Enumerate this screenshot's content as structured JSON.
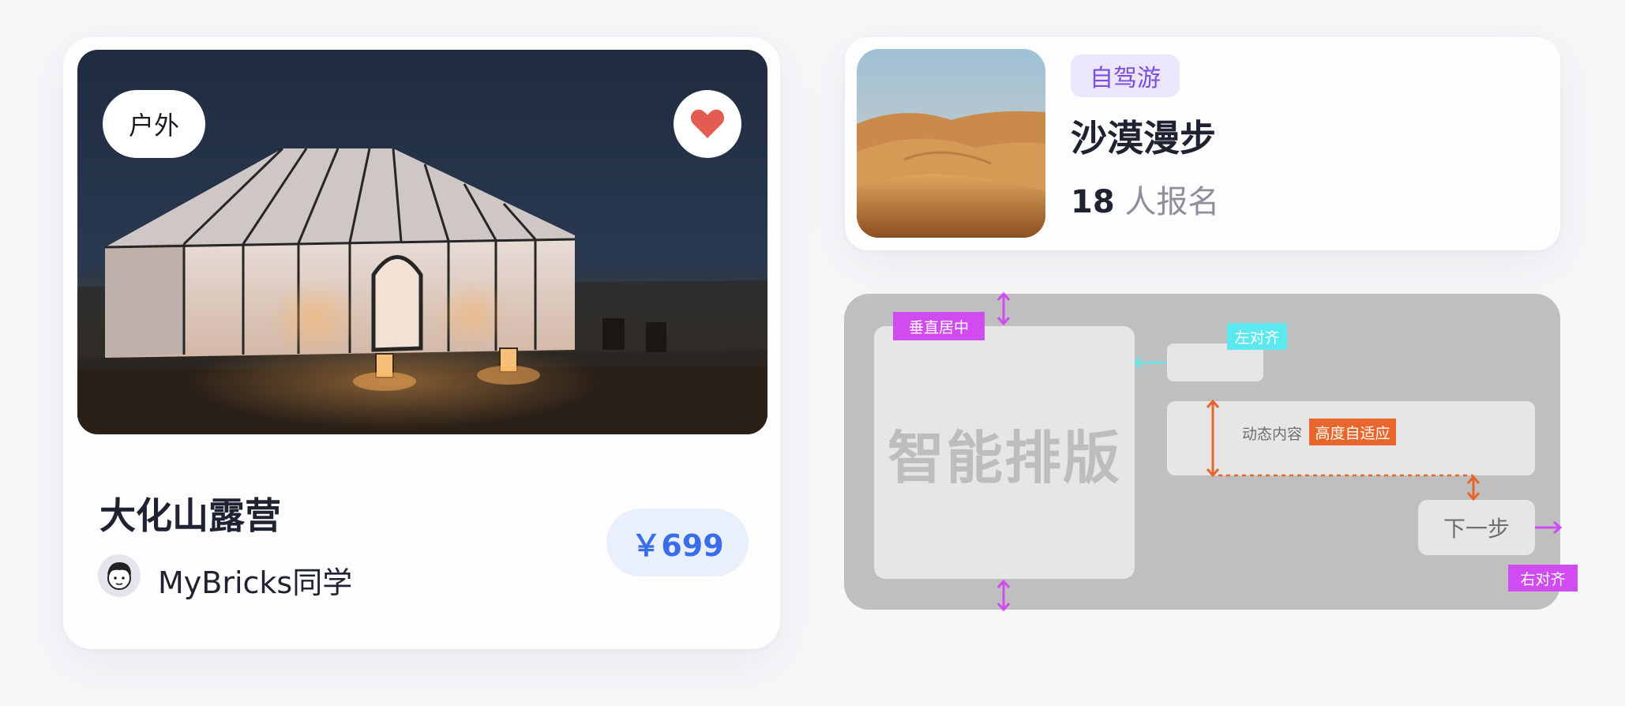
{
  "product_card": {
    "tag": "户外",
    "title": "大化山露营",
    "author": "MyBricks同学",
    "price": "￥699",
    "favorited": true,
    "hero_image": "night-desert-tent-photo",
    "colors": {
      "price_text": "#3a6ee8",
      "price_bg": "#e9f0fb",
      "heart": "#e45b52"
    }
  },
  "activity_card": {
    "badge": "自驾游",
    "title": "沙漠漫步",
    "count": "18",
    "count_suffix": "人报名",
    "thumb_image": "desert-dunes-photo",
    "colors": {
      "badge_text": "#7a4fe0",
      "badge_bg": "#ece6fd"
    }
  },
  "layout_diagram": {
    "main_text": "智能排版",
    "labels": {
      "vertical_center": "垂直居中",
      "left_align": "左对齐",
      "dynamic_content": "动态内容",
      "height_auto": "高度自适应",
      "right_align": "右对齐"
    },
    "next_button": "下一步",
    "colors": {
      "magenta": "#d14cf0",
      "cyan": "#5ce8ee",
      "orange": "#e8652b"
    }
  }
}
